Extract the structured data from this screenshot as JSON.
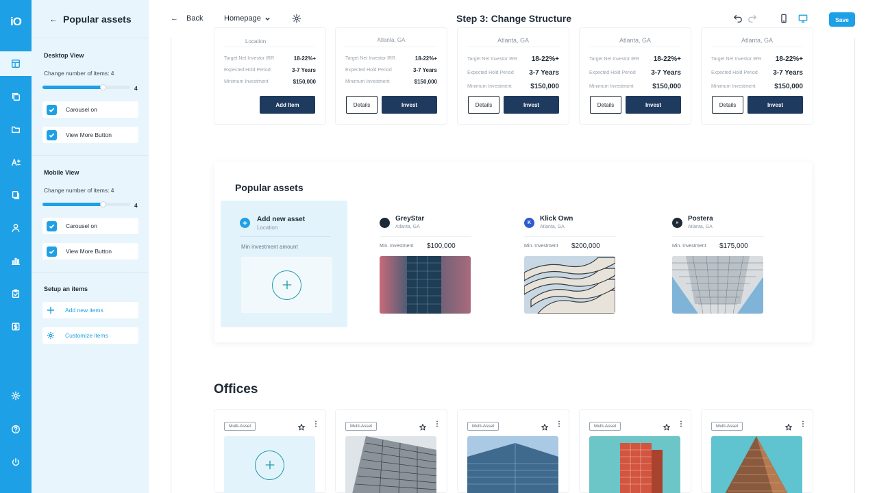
{
  "rail": {
    "logo": "iO",
    "icons": [
      "layout-icon",
      "copy-icon",
      "folder-icon",
      "text-icon",
      "documents-icon",
      "users-icon",
      "chart-icon",
      "clipboard-icon",
      "dollar-icon",
      "settings-icon",
      "help-icon",
      "power-icon"
    ]
  },
  "panel": {
    "title": "Popular assets",
    "desktop": {
      "heading": "Desktop View",
      "items_label": "Change number of items: 4",
      "items_value": "4",
      "items_fraction": 0.69,
      "carousel": "Carousel on",
      "view_more": "View More Button"
    },
    "mobile": {
      "heading": "Mobile View",
      "items_label": "Change number of items: 4",
      "items_value": "4",
      "items_fraction": 0.69,
      "carousel": "Carousel on",
      "view_more": "View More Button"
    },
    "setup": {
      "heading": "Setup an items",
      "add": "Add new items",
      "customize": "Customize items"
    }
  },
  "topbar": {
    "back": "Back",
    "page": "Homepage",
    "title": "Step 3: Change Structure",
    "save": "Save"
  },
  "top_cards": {
    "add_item": "Add Item",
    "details": "Details",
    "invest": "Invest",
    "first_location": "Location",
    "location": "Atlanta, GA",
    "rows": [
      {
        "k": "Target Net Investor IRR",
        "v": "18-22%+"
      },
      {
        "k": "Expected Hold Period",
        "v": "3-7 Years"
      },
      {
        "k": "Minimum Investment",
        "v": "$150,000"
      }
    ]
  },
  "popular": {
    "title": "Popular assets",
    "add": {
      "title": "Add new asset",
      "location": "Location",
      "min_label": "Min investment amount"
    },
    "assets": [
      {
        "name": "GreyStar",
        "location": "Atlanta, GA",
        "min_label": "Min. Investment",
        "min_value": "$100,000"
      },
      {
        "name": "Klick Own",
        "location": "Atlanta, GA",
        "min_label": "Min. Investment",
        "min_value": "$200,000"
      },
      {
        "name": "Postera",
        "location": "Atlanta, GA",
        "min_label": "Min. Investment",
        "min_value": "$175,000"
      }
    ]
  },
  "offices": {
    "title": "Offices",
    "tag": "Multi-Asset"
  },
  "colors": {
    "accent": "#1ea0e6",
    "navy": "#1f3a5f",
    "panel_bg": "#e8f5fc"
  }
}
